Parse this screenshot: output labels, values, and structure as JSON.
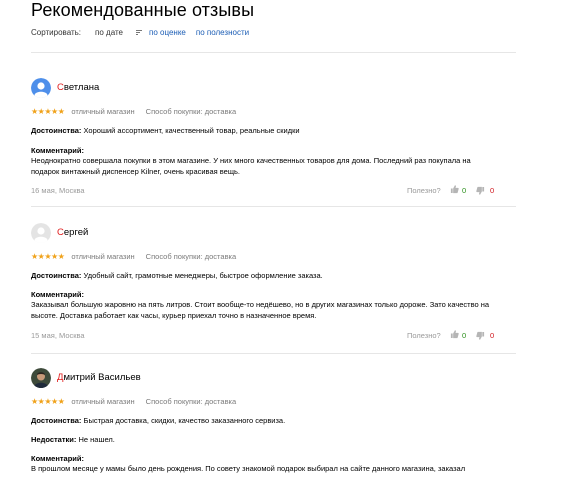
{
  "page": {
    "title": "Рекомендованные отзывы"
  },
  "sort": {
    "label": "Сортировать:",
    "options": [
      "по дате",
      "по оценке",
      "по полезности"
    ]
  },
  "colors": {
    "stars": "#f0a21a",
    "link": "#1b5db5",
    "name_first_letter": "#e01b1b",
    "useful_up": "#2a8f1a",
    "useful_down": "#d0141b"
  },
  "reviews": [
    {
      "name_first": "С",
      "name_rest": "ветлана",
      "avatar_icon": "default-avatar-blue-icon",
      "stars": "★★★★★",
      "rating_text": "отличный магазин",
      "purchase": "Способ покупки: доставка",
      "pros_label": "Достоинства:",
      "pros": "Хороший ассортимент, качественный товар, реальные скидки",
      "comment_label": "Комментарий:",
      "comment": "Неоднократно совершала покупки в этом магазине. У них много качественных товаров для дома. Последний раз покупала на подарок винтажный диспенсер Kilner, очень красивая вещь.",
      "date": "16 мая, Москва",
      "useful_label": "Полезно?",
      "up": "0",
      "down": "0"
    },
    {
      "name_first": "С",
      "name_rest": "ергей",
      "avatar_icon": "default-avatar-gray-icon",
      "stars": "★★★★★",
      "rating_text": "отличный магазин",
      "purchase": "Способ покупки: доставка",
      "pros_label": "Достоинства:",
      "pros": "Удобный сайт, грамотные менеджеры, быстрое оформление заказа.",
      "comment_label": "Комментарий:",
      "comment": "Заказывал большую жаровню на пять литров. Стоит вообще-то недёшево, но в других магазинах только дороже. Зато качество на высоте. Доставка работает как часы, курьер приехал точно в назначенное время.",
      "date": "15 мая, Москва",
      "useful_label": "Полезно?",
      "up": "0",
      "down": "0"
    },
    {
      "name_first": "Д",
      "name_rest": "митрий Васильев",
      "avatar_icon": "user-photo-avatar-icon",
      "stars": "★★★★★",
      "rating_text": "отличный магазин",
      "purchase": "Способ покупки: доставка",
      "pros_label": "Достоинства:",
      "pros": "Быстрая доставка, скидки, качество заказанного сервиза.",
      "cons_label": "Недостатки:",
      "cons": "Не нашел.",
      "comment_label": "Комментарий:",
      "comment": "В прошлом месяце у мамы было день рождения. По совету знакомой подарок выбирал на сайте данного магазина, заказал"
    }
  ]
}
